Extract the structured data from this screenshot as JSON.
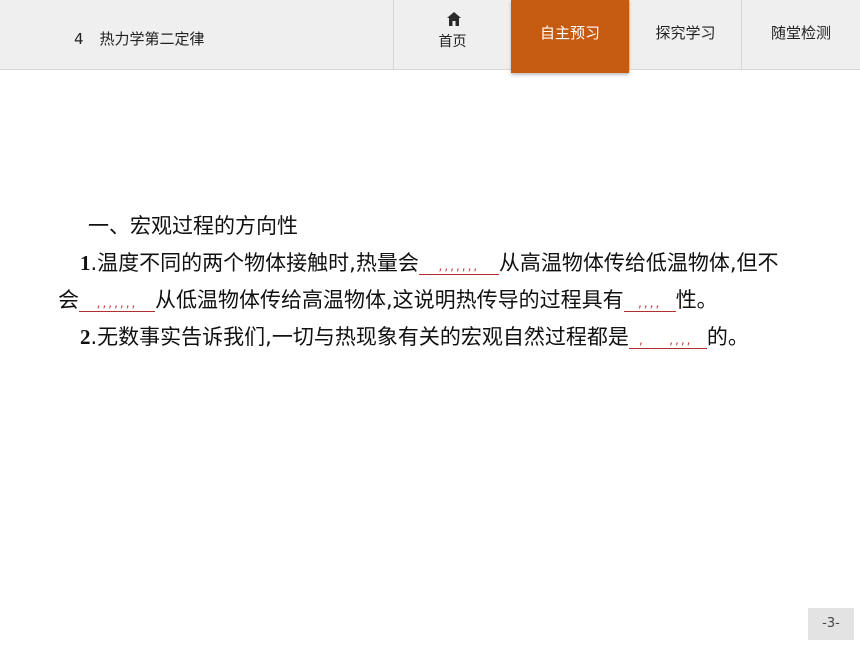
{
  "header": {
    "lesson_number": "4",
    "lesson_title": "热力学第二定律",
    "nav": {
      "home_label": "首页",
      "active_tab_label": "自主预习",
      "tab2_label": "探究学习",
      "tab3_label": "随堂检测"
    }
  },
  "content": {
    "heading": "一、宏观过程的方向性",
    "item1": {
      "index": "1",
      "text_a": ".温度不同的两个物体接触时,热量会",
      "blank_a": ",,,,,,,",
      "text_b": "从高温物体传给低温物体,但不会",
      "blank_b": ",,,,,,,",
      "text_c": "从低温物体传给高温物体,这说明热传导的过程具有",
      "blank_c": ",,,,",
      "text_d": "性。"
    },
    "item2": {
      "index": "2",
      "text_a": ".无数事实告诉我们,一切与热现象有关的宏观自然过程都是",
      "blank_a": ",",
      "blank_b": ",,,,",
      "text_b": "的。"
    }
  },
  "footer": {
    "page_number": "-3-"
  },
  "colors": {
    "active_tab": "#c55a11",
    "blank_underline": "#b03030"
  }
}
